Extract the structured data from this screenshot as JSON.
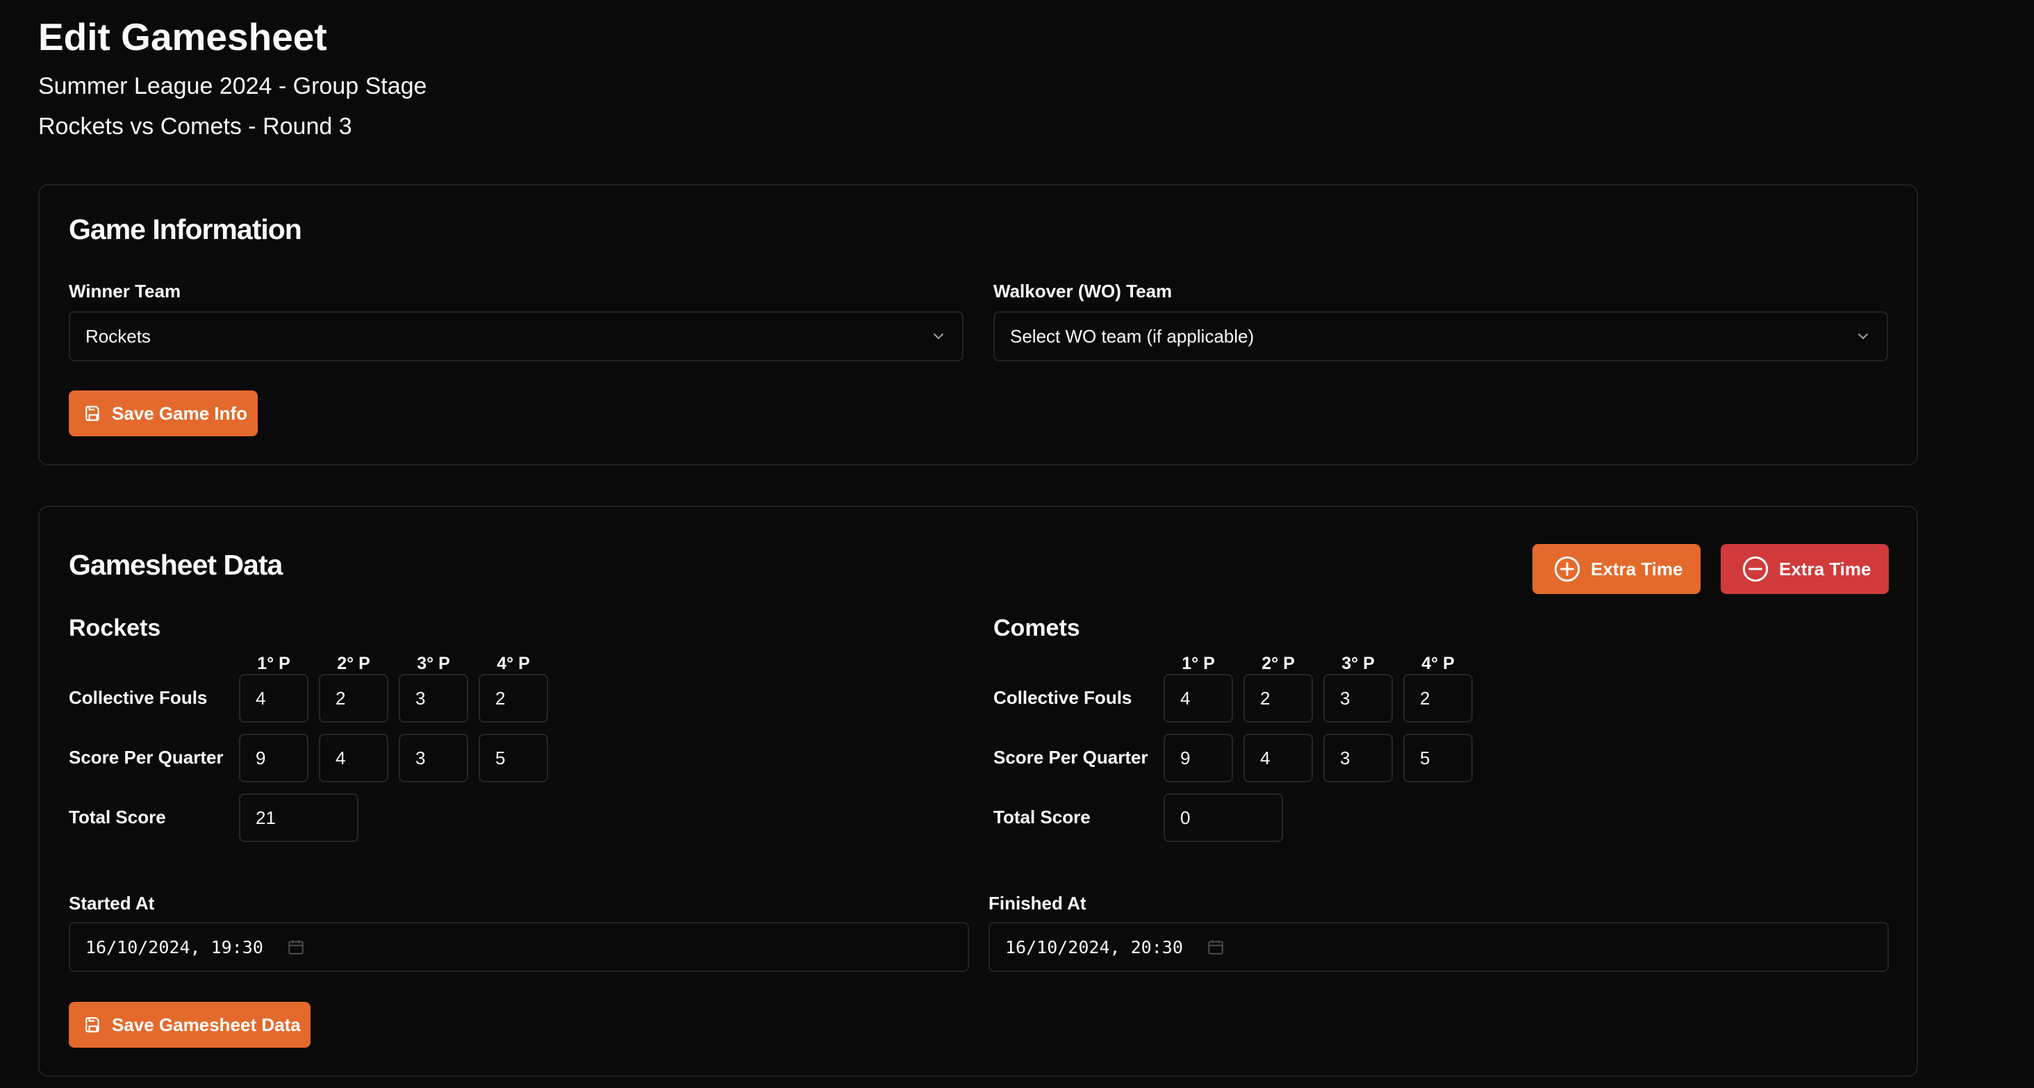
{
  "page": {
    "title": "Edit Gamesheet",
    "subtitle": "Summer League 2024 - Group Stage",
    "matchup": "Rockets vs Comets - Round 3"
  },
  "game_info": {
    "title": "Game Information",
    "winner_label": "Winner Team",
    "winner_value": "Rockets",
    "wo_label": "Walkover (WO) Team",
    "wo_placeholder": "Select WO team (if applicable)",
    "save_label": "Save Game Info"
  },
  "gamesheet": {
    "title": "Gamesheet Data",
    "add_extra_time_label": "Extra Time",
    "remove_extra_time_label": "Extra Time",
    "quarter_headers": [
      "1° P",
      "2° P",
      "3° P",
      "4° P"
    ],
    "row_labels": {
      "fouls": "Collective Fouls",
      "score": "Score Per Quarter",
      "total": "Total Score"
    },
    "teams": [
      {
        "name": "Rockets",
        "fouls": [
          "4",
          "2",
          "3",
          "2"
        ],
        "scores": [
          "9",
          "4",
          "3",
          "5"
        ],
        "total": "21"
      },
      {
        "name": "Comets",
        "fouls": [
          "4",
          "2",
          "3",
          "2"
        ],
        "scores": [
          "9",
          "4",
          "3",
          "5"
        ],
        "total": "0"
      }
    ],
    "started_label": "Started At",
    "started_value": "16/10/2024, 19:30",
    "finished_label": "Finished At",
    "finished_value": "16/10/2024, 20:30",
    "save_label": "Save Gamesheet Data"
  },
  "colors": {
    "background": "#0a0a0a",
    "accent_orange": "#e36a2c",
    "accent_red": "#d03a3a",
    "border": "#1f1f1f"
  },
  "icons": [
    "save-icon",
    "chevron-down-icon",
    "plus-circle-icon",
    "minus-circle-icon",
    "calendar-icon"
  ]
}
